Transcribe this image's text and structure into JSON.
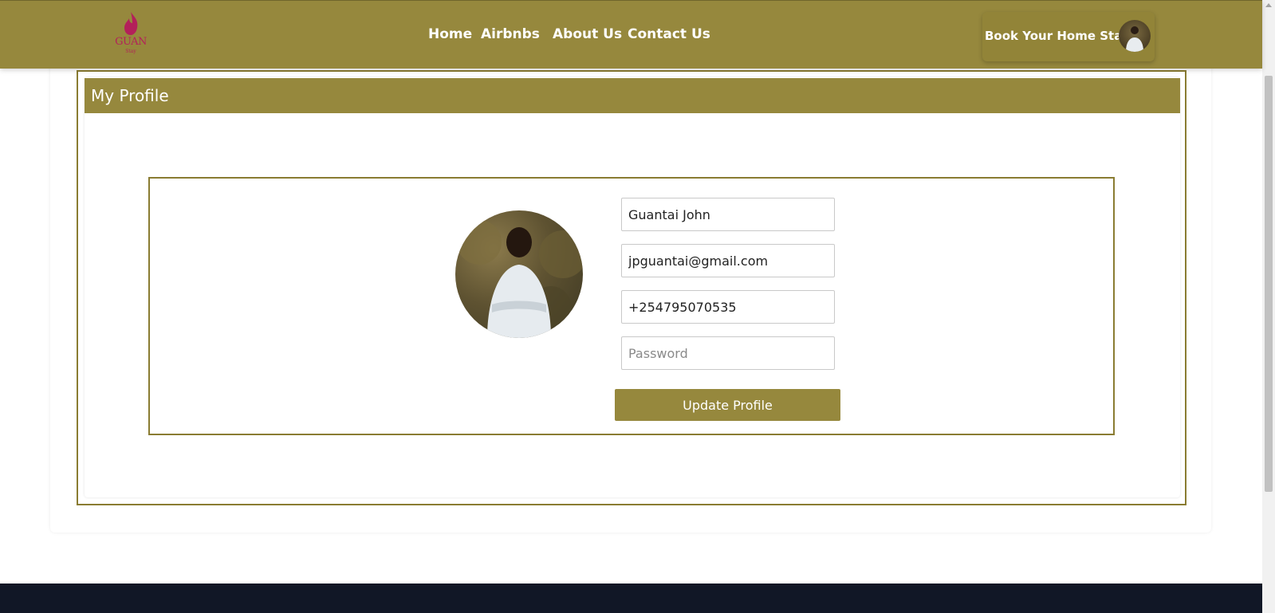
{
  "navbar": {
    "logo_text": "GUAN",
    "logo_sub": "Stay",
    "links": [
      "Home",
      "Airbnbs",
      "About Us",
      "Contact Us"
    ],
    "book_label": "Book Your Home Stay"
  },
  "profile": {
    "header": "My Profile",
    "name_value": "Guantai John",
    "email_value": "jpguantai@gmail.com",
    "phone_value": "+254795070535",
    "password_placeholder": "Password",
    "update_label": "Update Profile"
  },
  "colors": {
    "brand": "#96883d",
    "brand_border": "#8a7c32",
    "footer": "#111726",
    "logo": "#b3205a"
  },
  "icons": [
    "flame-logo-icon",
    "user-avatar",
    "profile-photo"
  ]
}
